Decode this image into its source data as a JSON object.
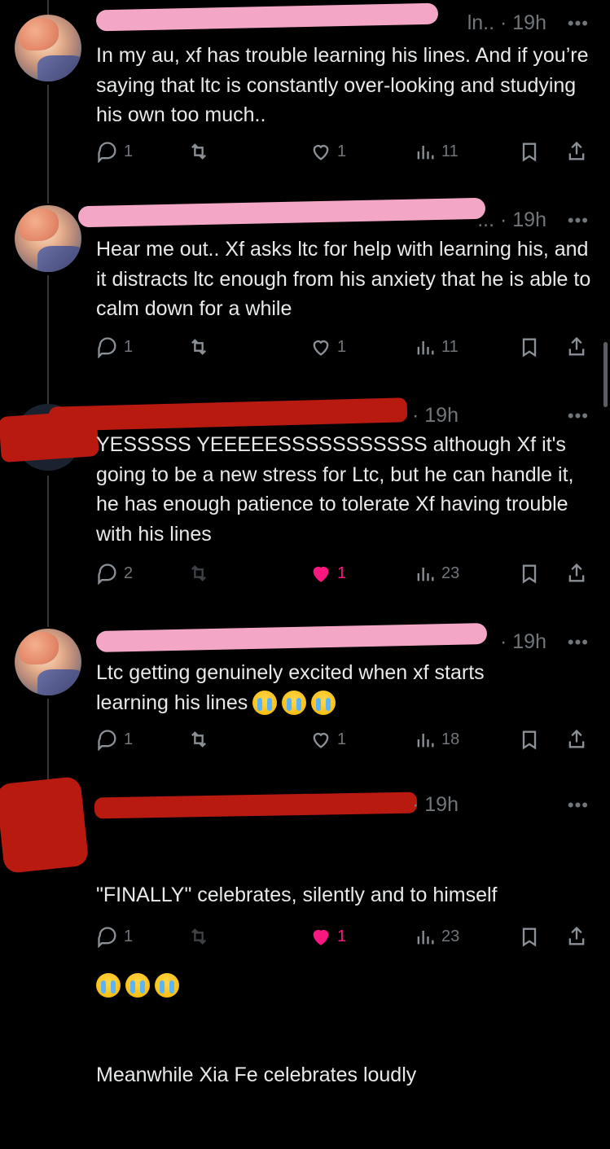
{
  "tweets": [
    {
      "time": "19h",
      "handle_fragment": "ln..",
      "text": "In my au, xf has trouble learning his lines. And if you’re saying that ltc is constantly over-looking and studying his own too much..",
      "replies": "1",
      "reposts": "",
      "likes": "1",
      "views": "11",
      "liked": false
    },
    {
      "time": "19h",
      "handle_fragment": "...",
      "text": "Hear me out.. Xf asks ltc for help with learning his, and it distracts ltc enough from his anxiety that he is able to calm down for a while",
      "replies": "1",
      "reposts": "",
      "likes": "1",
      "views": "11",
      "liked": false
    },
    {
      "time": "19h",
      "handle_fragment": "",
      "text": "YESSSSS YEEEEESSSSSSSSSSS although Xf it's going to be a new stress for Ltc, but he can handle it, he has enough patience to tolerate Xf having trouble with his lines",
      "replies": "2",
      "reposts": "",
      "likes": "1",
      "views": "23",
      "liked": true
    },
    {
      "time": "19h",
      "handle_fragment": "",
      "text": "Ltc getting genuinely excited when xf starts learning his lines",
      "emoji": [
        "loudly-crying-face",
        "loudly-crying-face",
        "loudly-crying-face"
      ],
      "replies": "1",
      "reposts": "",
      "likes": "1",
      "views": "18",
      "liked": false
    },
    {
      "time": "19h",
      "handle_fragment": "",
      "text": "\"FINALLY\" celebrates, silently and to himself",
      "emoji": [
        "loudly-crying-face",
        "loudly-crying-face",
        "loudly-crying-face"
      ],
      "text2": "Meanwhile Xia Fe celebrates loudly",
      "replies": "1",
      "reposts": "",
      "likes": "1",
      "views": "23",
      "liked": true
    }
  ],
  "ui": {
    "more_glyph": "•••",
    "time_sep": "·",
    "colors": {
      "background": "#000000",
      "text": "#e7e9ea",
      "muted": "#71767b",
      "like_active": "#f91880",
      "redact_pink": "#f4a6c6",
      "redact_red": "#b81a10"
    }
  }
}
